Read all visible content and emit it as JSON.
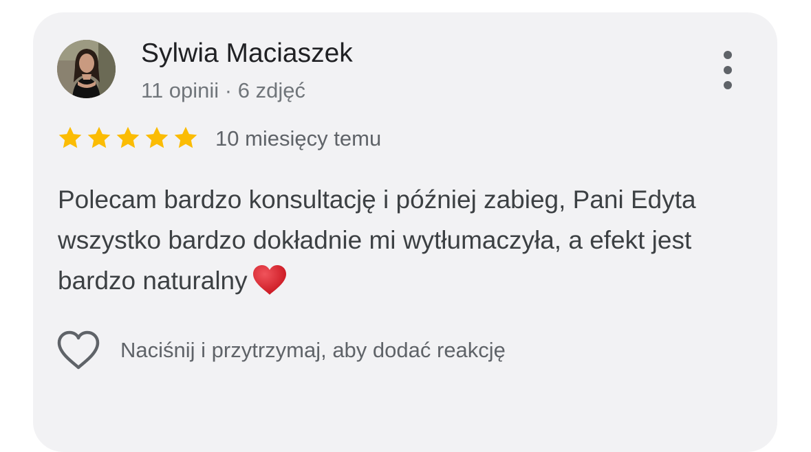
{
  "review": {
    "author_name": "Sylwia Maciaszek",
    "author_meta": "11 opinii · 6 zdjęć",
    "rating": 5,
    "rating_max": 5,
    "date": "10 miesięcy temu",
    "text": "Polecam bardzo konsultację i później zabieg, Pani Edyta wszystko bardzo dokładnie mi wytłumaczyła, a efekt jest bardzo naturalny",
    "text_emoji": "red-heart-emoji",
    "reaction_hint": "Naciśnij i przytrzymaj, aby dodać reakcję"
  },
  "icons": {
    "more": "more-vert-icon",
    "like": "heart-outline-icon",
    "star": "star-icon"
  },
  "colors": {
    "card_background": "#f2f2f4",
    "star": "#fbbc04",
    "heart_emoji": "#d8202a",
    "primary_text": "#202124",
    "secondary_text": "#70757a"
  }
}
